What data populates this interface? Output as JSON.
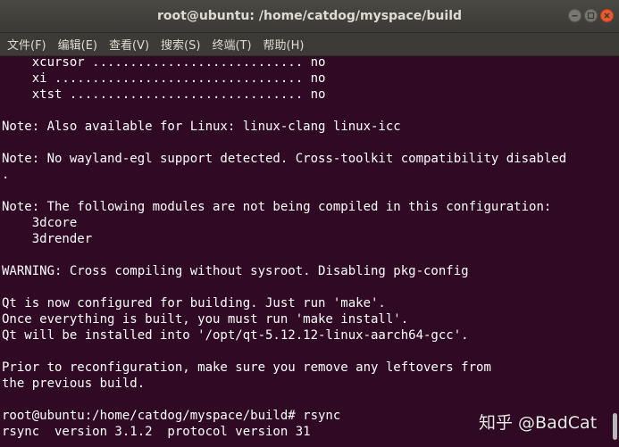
{
  "window": {
    "title": "root@ubuntu: /home/catdog/myspace/build"
  },
  "menu": [
    {
      "label": "文件(F)"
    },
    {
      "label": "编辑(E)"
    },
    {
      "label": "查看(V)"
    },
    {
      "label": "搜索(S)"
    },
    {
      "label": "终端(T)"
    },
    {
      "label": "帮助(H)"
    }
  ],
  "terminal": {
    "lines": [
      "    xcursor ............................ no",
      "    xi ................................. no",
      "    xtst ............................... no",
      "",
      "Note: Also available for Linux: linux-clang linux-icc",
      "",
      "Note: No wayland-egl support detected. Cross-toolkit compatibility disabled",
      ".",
      "",
      "Note: The following modules are not being compiled in this configuration:",
      "    3dcore",
      "    3drender",
      "",
      "WARNING: Cross compiling without sysroot. Disabling pkg-config",
      "",
      "Qt is now configured for building. Just run 'make'.",
      "Once everything is built, you must run 'make install'.",
      "Qt will be installed into '/opt/qt-5.12.12-linux-aarch64-gcc'.",
      "",
      "Prior to reconfiguration, make sure you remove any leftovers from",
      "the previous build.",
      "",
      "root@ubuntu:/home/catdog/myspace/build# rsync",
      "rsync  version 3.1.2  protocol version 31"
    ]
  },
  "watermark": "知乎 @BadCat",
  "colors": {
    "terminal_bg": "#300a24",
    "titlebar_bg": "#3c3b37",
    "close_button": "#e9582f"
  }
}
